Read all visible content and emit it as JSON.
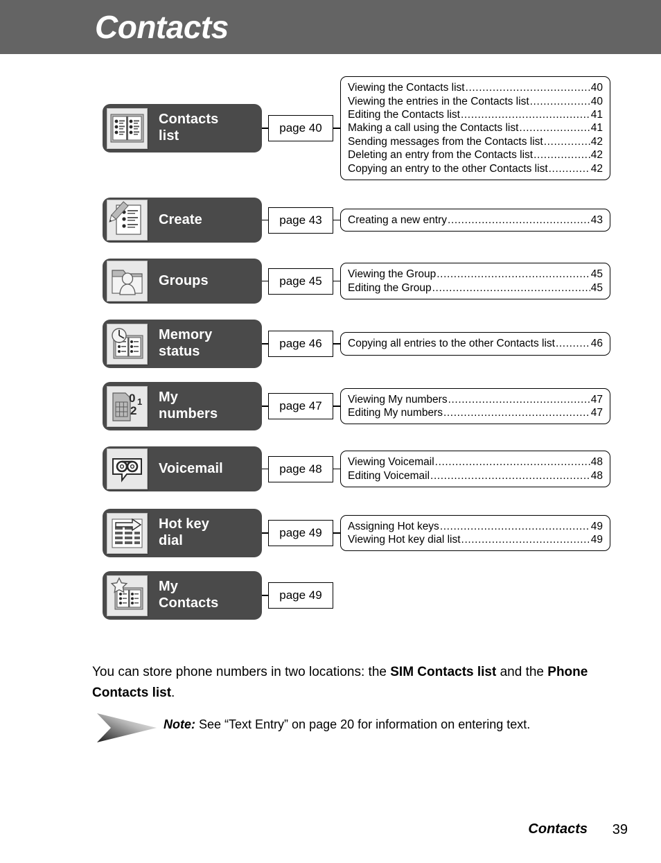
{
  "header": {
    "title": "Contacts"
  },
  "sections": [
    {
      "icon": "address-book-icon",
      "label": "Contacts\nlist",
      "page": "page 40",
      "toc": [
        {
          "text": "Viewing the Contacts list",
          "page": "40"
        },
        {
          "text": "Viewing the entries in the Contacts list",
          "page": "40"
        },
        {
          "text": "Editing the Contacts list",
          "page": "41"
        },
        {
          "text": "Making a call using the Contacts list",
          "page": "41"
        },
        {
          "text": "Sending messages from the Contacts list",
          "page": "42"
        },
        {
          "text": "Deleting an entry from the Contacts list",
          "page": "42"
        },
        {
          "text": "Copying an entry to the other Contacts list",
          "page": "42"
        }
      ]
    },
    {
      "icon": "pen-writing-list-icon",
      "label": "Create",
      "page": "page 43",
      "toc": [
        {
          "text": "Creating a new entry",
          "page": "43"
        }
      ]
    },
    {
      "icon": "folder-person-icon",
      "label": "Groups",
      "page": "page 45",
      "toc": [
        {
          "text": "Viewing the Group",
          "page": "45"
        },
        {
          "text": "Editing the Group",
          "page": "45"
        }
      ]
    },
    {
      "icon": "memory-gauge-book-icon",
      "label": "Memory\nstatus",
      "page": "page 46",
      "toc": [
        {
          "text": "Copying all entries to the other Contacts list",
          "page": "46"
        }
      ]
    },
    {
      "icon": "sim-card-numbers-icon",
      "label": "My\nnumbers",
      "page": "page 47",
      "toc": [
        {
          "text": "Viewing My numbers",
          "page": "47"
        },
        {
          "text": "Editing My numbers",
          "page": "47"
        }
      ]
    },
    {
      "icon": "voicemail-tape-bubble-icon",
      "label": "Voicemail",
      "page": "page 48",
      "toc": [
        {
          "text": "Viewing Voicemail",
          "page": "48"
        },
        {
          "text": "Editing Voicemail",
          "page": "48"
        }
      ]
    },
    {
      "icon": "keypad-arrow-icon",
      "label": "Hot key\ndial",
      "page": "page 49",
      "toc": [
        {
          "text": "Assigning Hot keys",
          "page": "49"
        },
        {
          "text": "Viewing Hot key dial list",
          "page": "49"
        }
      ]
    },
    {
      "icon": "star-book-icon",
      "label": "My\nContacts",
      "page": "page 49",
      "toc": []
    }
  ],
  "body": {
    "intro_part1": "You can store phone numbers in two locations: the ",
    "intro_bold1": "SIM Contacts list",
    "intro_part2": " and the ",
    "intro_bold2": "Phone Contacts list",
    "intro_part3": "."
  },
  "note": {
    "label": "Note:",
    "text": " See “Text Entry” on page 20 for information on entering text."
  },
  "footer": {
    "title": "Contacts",
    "page": "39"
  },
  "colors": {
    "header_bar": "#646464",
    "chip": "#4a4a4a",
    "icon_tile": "#e8e8e8",
    "text": "#000000"
  }
}
